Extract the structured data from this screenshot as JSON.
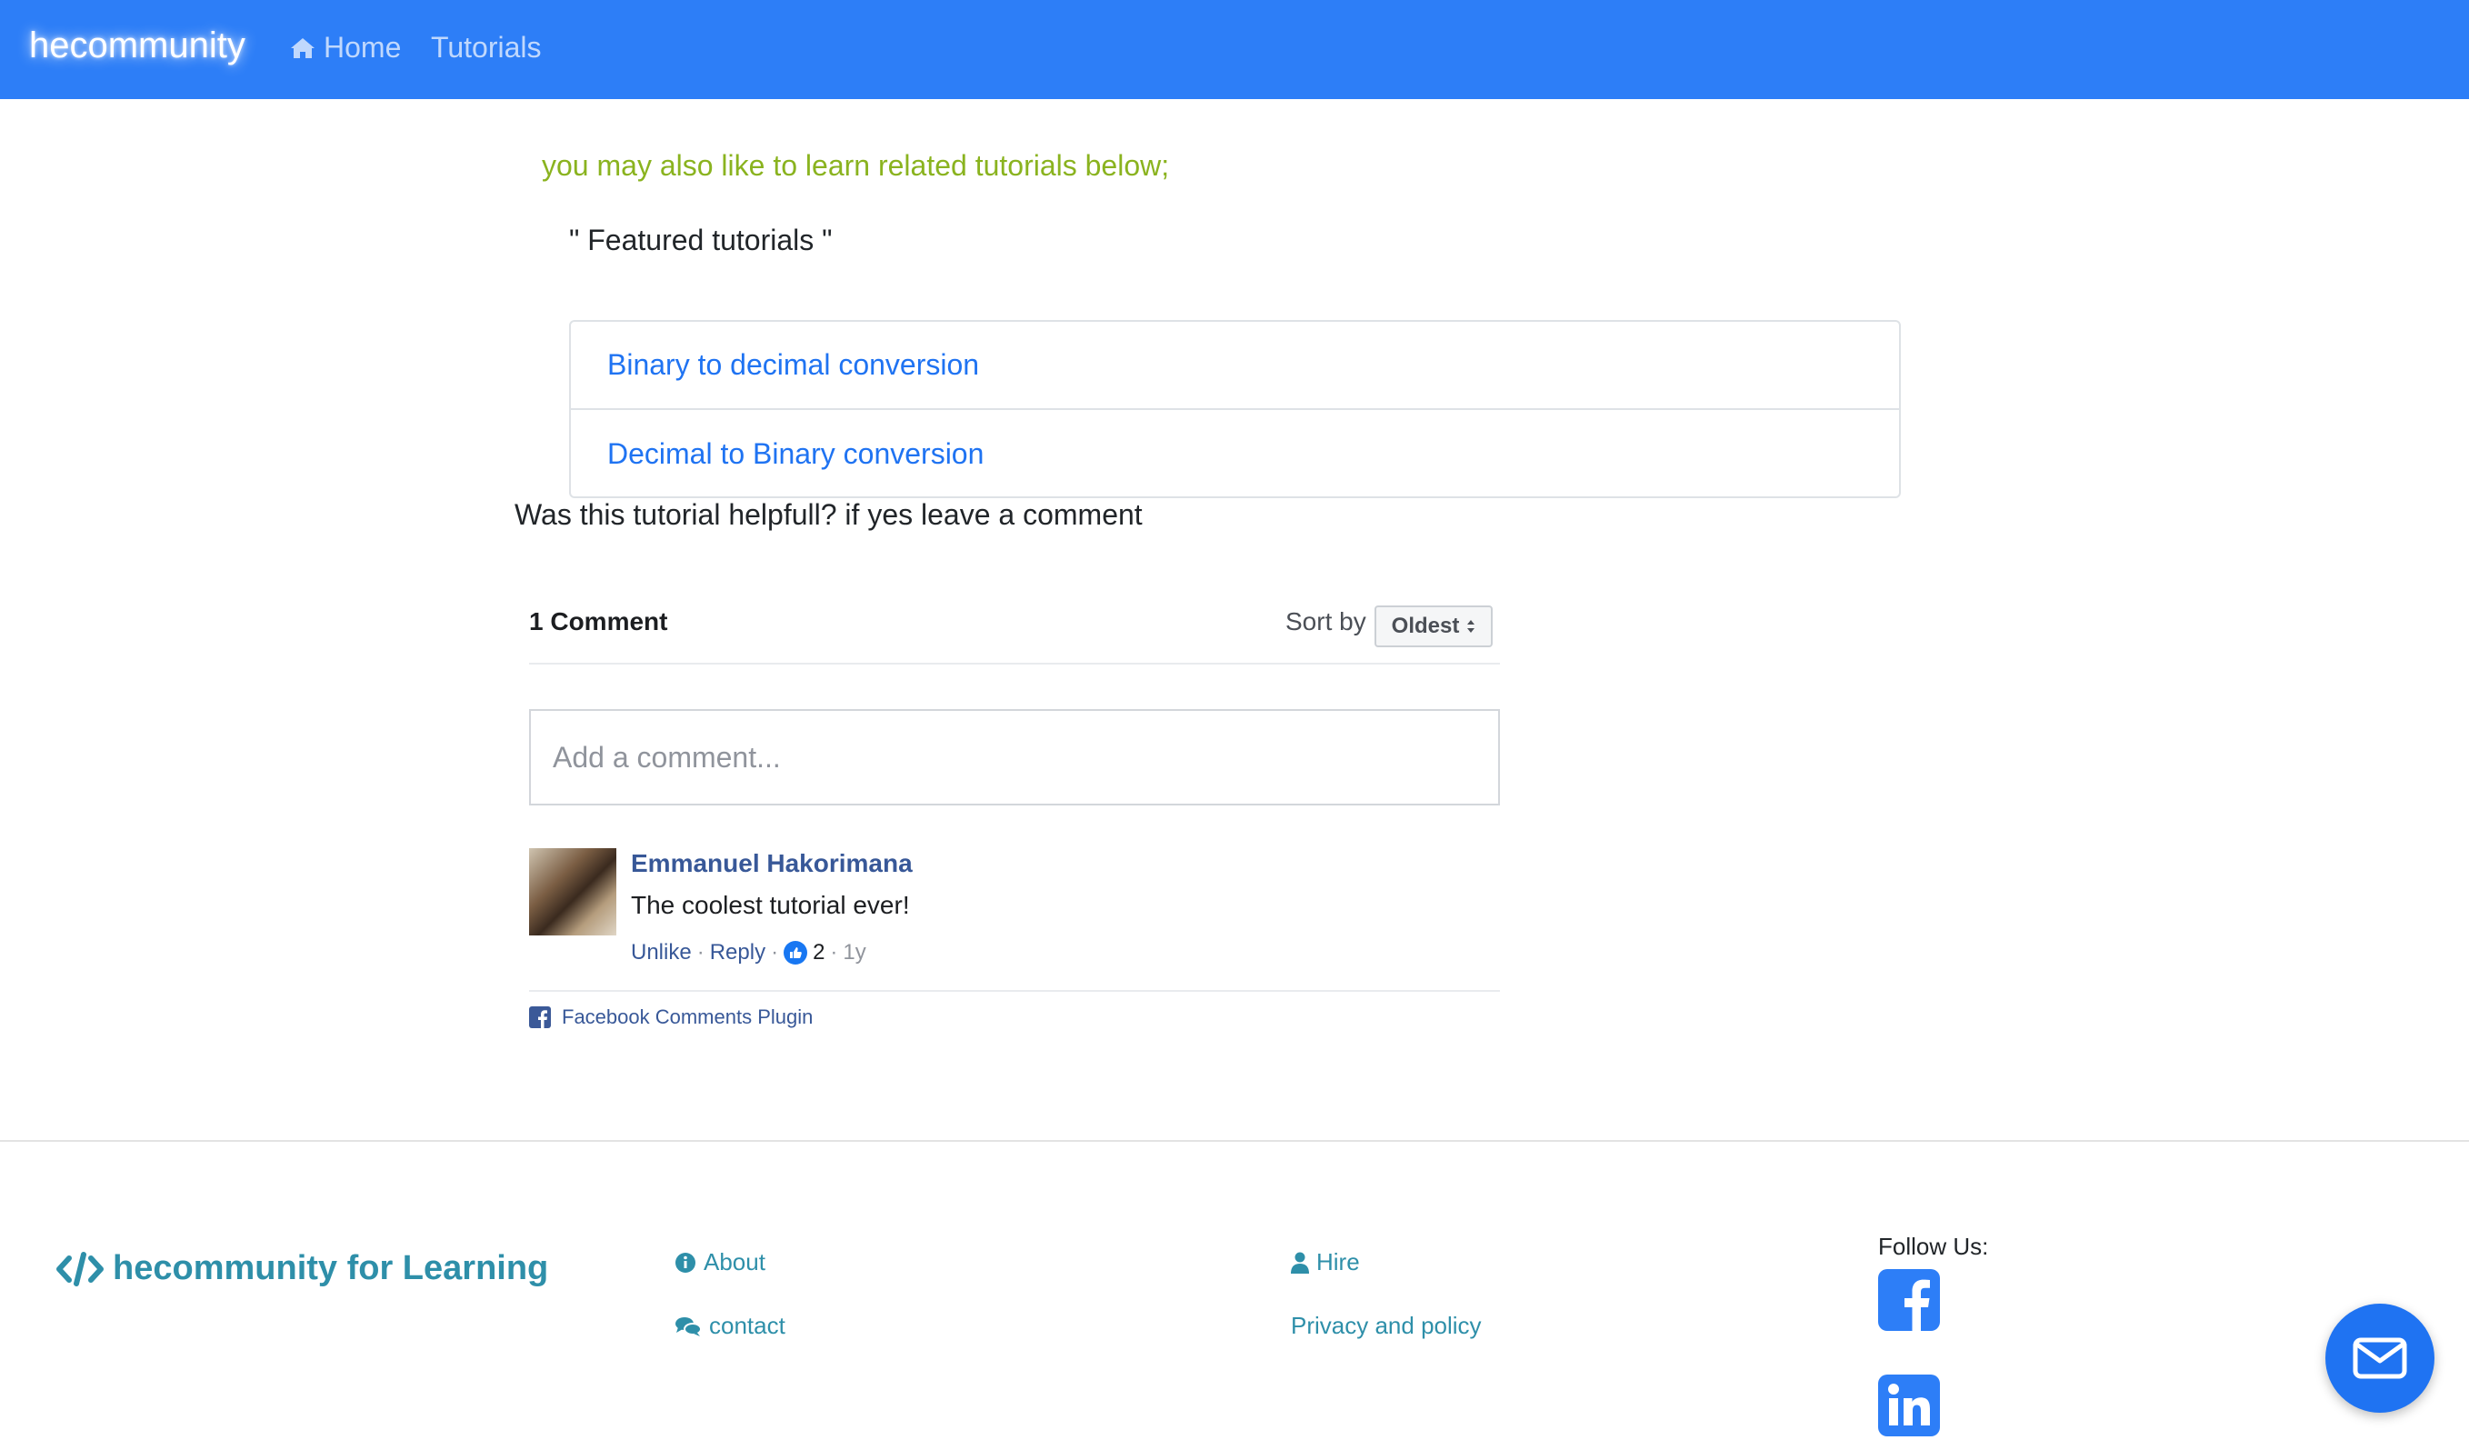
{
  "navbar": {
    "brand": "hecommunity",
    "links": [
      {
        "label": "Home",
        "icon": "home-icon"
      },
      {
        "label": "Tutorials"
      }
    ]
  },
  "content": {
    "related_text": "you may also like to learn related tutorials below;",
    "featured_heading": "\" Featured tutorials \"",
    "tutorials": [
      {
        "label": "Binary to decimal conversion"
      },
      {
        "label": "Decimal to Binary conversion"
      }
    ],
    "helpful_prompt": "Was this tutorial helpfull? if yes leave a comment"
  },
  "comments": {
    "count_label": "1 Comment",
    "sort_label": "Sort by",
    "sort_value": "Oldest",
    "input_placeholder": "Add a comment...",
    "items": [
      {
        "author": "Emmanuel Hakorimana",
        "text": "The coolest tutorial ever!",
        "unlike": "Unlike",
        "reply": "Reply",
        "likes": "2",
        "age": "1y"
      }
    ],
    "plugin_label": "Facebook Comments Plugin"
  },
  "footer": {
    "brand": "hecommunity for Learning",
    "links": {
      "about": "About",
      "contact": "contact",
      "hire": "Hire",
      "privacy": "Privacy and policy"
    },
    "follow_label": "Follow Us:"
  },
  "colors": {
    "navbar": "#2d7ef7",
    "link": "#1f73f2",
    "related": "#8ab31f",
    "footer_accent": "#2e8fa9",
    "facebook_name": "#385898"
  }
}
